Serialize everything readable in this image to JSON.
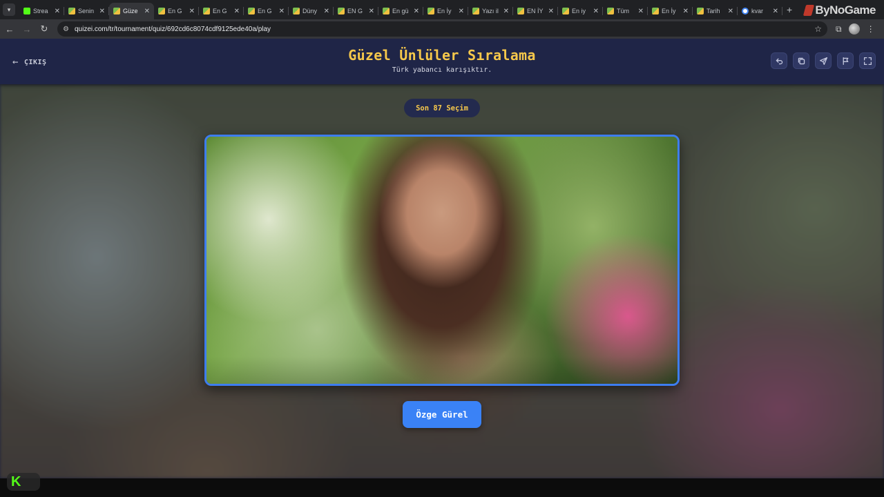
{
  "browser": {
    "tabs": [
      {
        "label": "Strea",
        "favicon": "kick-icon"
      },
      {
        "label": "Senin",
        "favicon": "book-icon"
      },
      {
        "label": "Güze",
        "favicon": "book-icon",
        "active": true
      },
      {
        "label": "En G",
        "favicon": "book-icon"
      },
      {
        "label": "En G",
        "favicon": "book-icon"
      },
      {
        "label": "En G",
        "favicon": "book-icon"
      },
      {
        "label": "Düny",
        "favicon": "book-icon"
      },
      {
        "label": "EN G",
        "favicon": "book-icon"
      },
      {
        "label": "En gü",
        "favicon": "book-icon"
      },
      {
        "label": "En İy",
        "favicon": "book-icon"
      },
      {
        "label": "Yazı il",
        "favicon": "book-icon"
      },
      {
        "label": "EN İY",
        "favicon": "book-icon"
      },
      {
        "label": "En iy",
        "favicon": "book-icon"
      },
      {
        "label": "Tüm",
        "favicon": "book-icon"
      },
      {
        "label": "En İy",
        "favicon": "book-icon"
      },
      {
        "label": "Tarih",
        "favicon": "book-icon"
      },
      {
        "label": "kvar",
        "favicon": "google-icon"
      }
    ],
    "close_glyph": "✕",
    "new_tab_glyph": "+",
    "url": "quizei.com/tr/tournament/quiz/692cd6c8074cdf9125ede40a/play",
    "watermark": "ByNoGame"
  },
  "header": {
    "exit_label": "ÇIKIŞ",
    "title": "Güzel Ünlüler Sıralama",
    "subtitle": "Türk yabancı karışıktır.",
    "actions": [
      "undo-icon",
      "copy-icon",
      "share-icon",
      "flag-icon",
      "fullscreen-icon"
    ]
  },
  "round": {
    "label": "Son 87 Seçim"
  },
  "candidate": {
    "name": "Özge Gürel"
  },
  "colors": {
    "accent_yellow": "#f6c84b",
    "header_bg": "#1f2547",
    "card_border": "#3d7df0",
    "choice_button": "#3a82f6",
    "kick_green": "#53fc18"
  },
  "taskbar": {
    "pinned_app": "K"
  }
}
